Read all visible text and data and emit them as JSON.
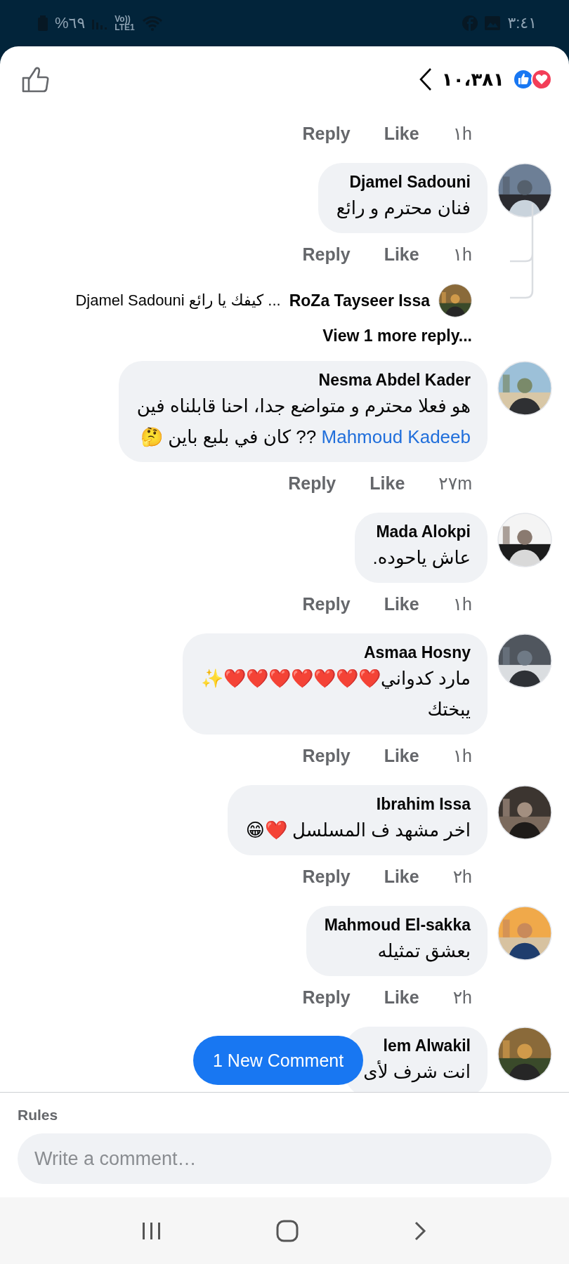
{
  "status_bar": {
    "battery_percent": "%٦٩",
    "volte_top": "Vo))",
    "volte_bottom": "LTE1",
    "time": "٣:٤١"
  },
  "header": {
    "reaction_count": "١٠،٣٨١"
  },
  "comments": [
    {
      "kind": "actions",
      "reply": "Reply",
      "like": "Like",
      "time": "١h"
    },
    {
      "kind": "comment",
      "name": "Djamel Sadouni",
      "lines": [
        [
          {
            "text": "فنان محترم و رائع"
          }
        ]
      ],
      "reply": "Reply",
      "like": "Like",
      "time": "١h",
      "thread": {
        "preview_name": "RoZa Tayseer Issa",
        "preview_text": "... كيفك يا رائع Djamel Sadouni",
        "more": "View 1 more reply..."
      }
    },
    {
      "kind": "comment",
      "name": "Nesma Abdel Kader",
      "lines": [
        [
          {
            "text": "هو فعلا محترم و متواضع جدا، احنا قابلناه فين"
          }
        ],
        [
          {
            "text": "Mahmoud Kadeeb",
            "link": true
          },
          {
            "text": " ?? كان في بلبع باين 🤔"
          }
        ]
      ],
      "reply": "Reply",
      "like": "Like",
      "time": "٢٧m"
    },
    {
      "kind": "comment",
      "name": "Mada Alokpi",
      "lines": [
        [
          {
            "text": "عاش ياحوده."
          }
        ]
      ],
      "reply": "Reply",
      "like": "Like",
      "time": "١h"
    },
    {
      "kind": "comment",
      "name": "Asmaa Hosny",
      "lines": [
        [
          {
            "text": "مارد كدواني❤️❤️❤️❤️❤️❤️❤️✨"
          }
        ],
        [
          {
            "text": "يبختك"
          }
        ]
      ],
      "reply": "Reply",
      "like": "Like",
      "time": "١h"
    },
    {
      "kind": "comment",
      "name": "Ibrahim Issa",
      "lines": [
        [
          {
            "text": "اخر مشهد ف المسلسل ❤️😁"
          }
        ]
      ],
      "reply": "Reply",
      "like": "Like",
      "time": "٢h"
    },
    {
      "kind": "comment",
      "name": "Mahmoud El-sakka",
      "lines": [
        [
          {
            "text": "بعشق تمثيله"
          }
        ]
      ],
      "reply": "Reply",
      "like": "Like",
      "time": "٢h"
    },
    {
      "kind": "comment",
      "name": "lem Alwakil",
      "lines": [
        [
          {
            "text": "انت شرف لأى"
          }
        ]
      ]
    }
  ],
  "new_comment_button": "1 New Comment",
  "composer": {
    "label": "Rules",
    "placeholder": "Write a comment…"
  }
}
